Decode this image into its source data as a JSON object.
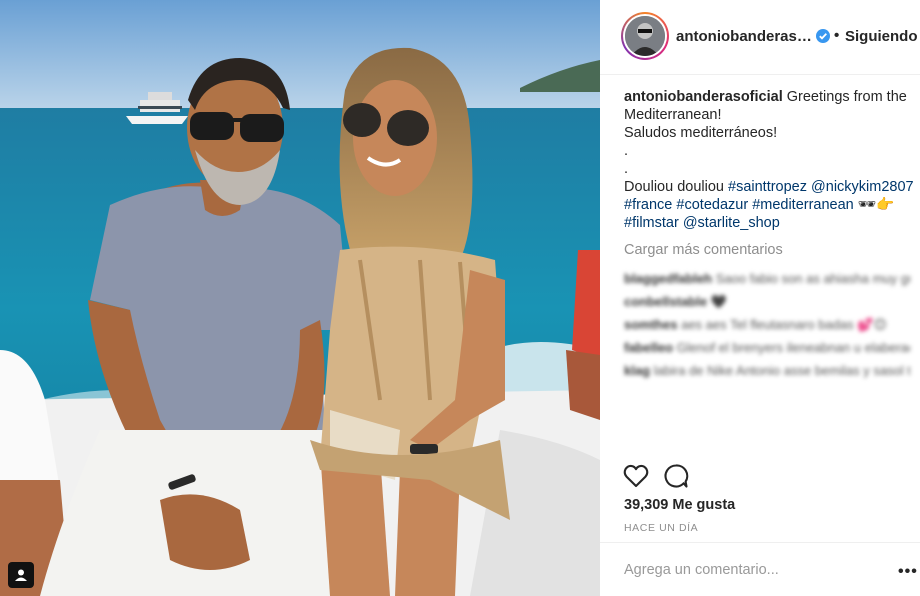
{
  "header": {
    "username": "antoniobanderasoficial",
    "follow_status": "Siguiendo",
    "separator": "•"
  },
  "caption": {
    "username": "antoniobanderasoficial",
    "line1": "Greetings from the Mediterranean!",
    "line2": "Saludos mediterráneos!",
    "dot1": ".",
    "dot2": ".",
    "line3_text": "Douliou douliou ",
    "tags": [
      "#sainttropez",
      "@nickykim2807",
      "#france",
      "#cotedazur",
      "#mediterranean",
      "#filmstar",
      "@starlite_shop"
    ],
    "emoji": "🕶👉"
  },
  "load_more_label": "Cargar más comentarios",
  "blurred_comments": [
    {
      "user": "blaggedfableh",
      "text": "Saoo fabio son as ahiasha muy gusta"
    },
    {
      "user": "conbellstable",
      "text": "🖤"
    },
    {
      "user": "somthes",
      "text": "aes aes Tel fleutasnaro badas 💕😊"
    },
    {
      "user": "fabelleo",
      "text": "Glenof el brenyers ileneabnan u elaberacionsaras rleglaby aresy a sasor"
    },
    {
      "user": "klag",
      "text": "labira de Nike Antonio asse bemilas y sasol ten'nnae neas . . Nelimo"
    }
  ],
  "likes": "39,309 Me gusta",
  "time_ago": "HACE UN DÍA",
  "comment_placeholder": "Agrega un comentario...",
  "more_label": "•••",
  "icons": {
    "verified": "verified-badge-icon",
    "like": "heart-icon",
    "comment": "speech-bubble-icon",
    "tag": "user-tag-icon",
    "more": "more-options-icon"
  },
  "colors": {
    "verified_blue": "#3897f0",
    "link_blue": "#00376b",
    "muted": "#8e8e8e"
  }
}
